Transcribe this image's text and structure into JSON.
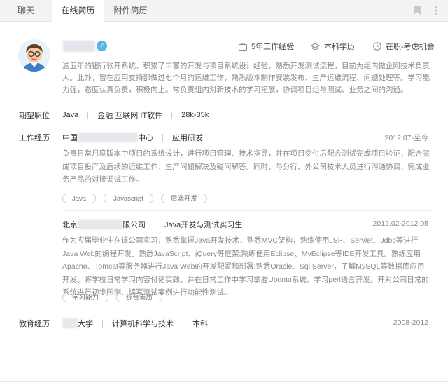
{
  "tabs": [
    {
      "label": "聊天"
    },
    {
      "label": "在线简历"
    },
    {
      "label": "附件简历"
    }
  ],
  "profile": {
    "gender_icon": "male-icon",
    "experience": "5年工作经验",
    "education": "本科学历",
    "status": "在职-考虑机会",
    "intro": "逾五年的银行软开系统，积累了丰富的开发与项目系统设计经验，熟悉开发测试流程，目前为组内做企网技术负责人。此外，曾在应用支持部做过七个月的运维工作，熟悉版本制作安装发布、生产运维流程、问题处理等。学习能力强，态度认真负责，积极向上。常负责组内对新技术的学习拓展，协调项目组与测试、业务之间的沟通。"
  },
  "expect": {
    "label": "期望职位",
    "position": "Java",
    "industry": "金融 互联网 IT软件",
    "salary": "28k-35k"
  },
  "work": {
    "label": "工作经历",
    "jobs": [
      {
        "company_prefix": "中国",
        "company_suffix": "中心",
        "role": "应用研发",
        "date": "2012.07-至今",
        "desc": "负责日常月度版本中项目的系统设计，进行项目管理、技术指导，并在项目交付后配合测试完成项目验证，配合完成项目投产及后续的运维工作，生产问题解决及疑问解答。同时，与分行、外公司技术人员进行沟通协调，完成业务产品的对接调试工作。",
        "tags": [
          "Java",
          "Javascript",
          "后端开发"
        ]
      },
      {
        "company_prefix": "北京",
        "company_suffix": "限公司",
        "role": "Java开发与测试实习生",
        "date": "2012.02-2012.05",
        "desc": "作为应届毕业生在该公司实习，熟悉掌握Java开发技术，熟悉MVC架构，熟练使用JSP、Servlet、Jdbc等进行Java Web的编程开发。熟悉JavaScript、jQuery等框架;熟练使用Eclipse、MyEclipse等IDE开发工具。熟练应用Apache、Tomcat等服务器进行Java Web的开发配置和部署;熟悉Oracle、Sql Server，了解MySQL等数据库应用开发。将学校日常学习内容付诸实践，并在日常工作中学习掌握Ubuntu系统、学习perl语言开发。开对公司日常的系统进行初步压测、编写测试案例进行功能性测试。",
        "tags": [
          "学习能力",
          "综合素质"
        ]
      }
    ]
  },
  "education": {
    "label": "教育经历",
    "school_suffix": "大学",
    "major": "计算机科学与技术",
    "degree": "本科",
    "date": "2008-2012"
  },
  "colors": {
    "tabbar_bg": "#f3f3f3",
    "desc_text": "#8a8a8a",
    "gender_badge": "#57b4e8"
  }
}
